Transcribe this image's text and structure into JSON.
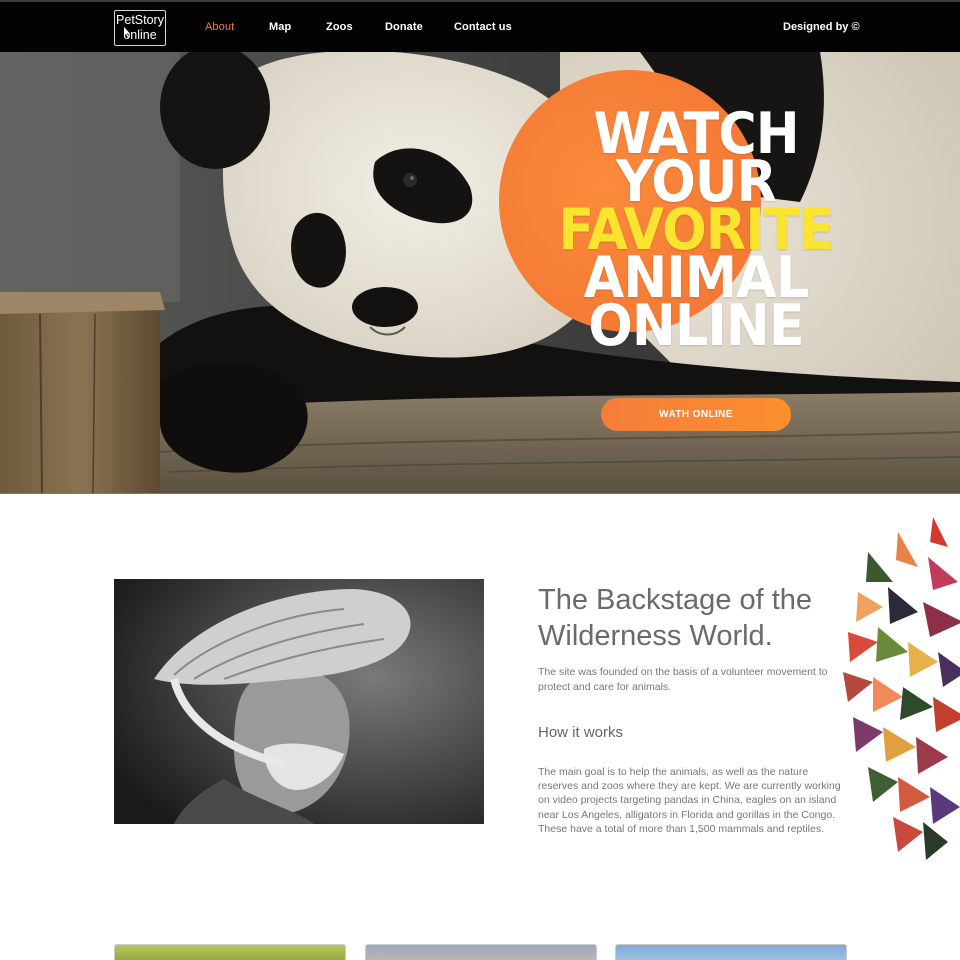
{
  "brand": {
    "logo_line1": "PetStory",
    "logo_line2": "online"
  },
  "nav": {
    "items": [
      {
        "label": "About",
        "active": true
      },
      {
        "label": "Map",
        "active": false
      },
      {
        "label": "Zoos",
        "active": false
      },
      {
        "label": "Donate",
        "active": false
      },
      {
        "label": "Contact us",
        "active": false
      }
    ],
    "credit": "Designed by ©"
  },
  "hero": {
    "title_line1": "WATCH",
    "title_line2": "YOUR",
    "title_line3": "FAVORITE",
    "title_line4": "ANIMAL",
    "title_line5": "ONLINE",
    "button_label": "WATH ONLINE"
  },
  "about": {
    "title": "The Backstage of the Wilderness World.",
    "intro": "The site was founded on the basis of a volunteer movement to protect and care for animals.",
    "how_title": "How it works",
    "how_text": "The main goal is to help the animals, as well as the nature reserves and zoos where they are kept. We are currently working on video projects targeting pandas in China, eagles on an island near Los Angeles, alligators in Florida and gorillas in the Congo. These have a total of more than 1,500 mammals and reptiles."
  },
  "colors": {
    "accent": "#f47f3c",
    "highlight": "#fbe430",
    "nav_bg": "#030303"
  }
}
